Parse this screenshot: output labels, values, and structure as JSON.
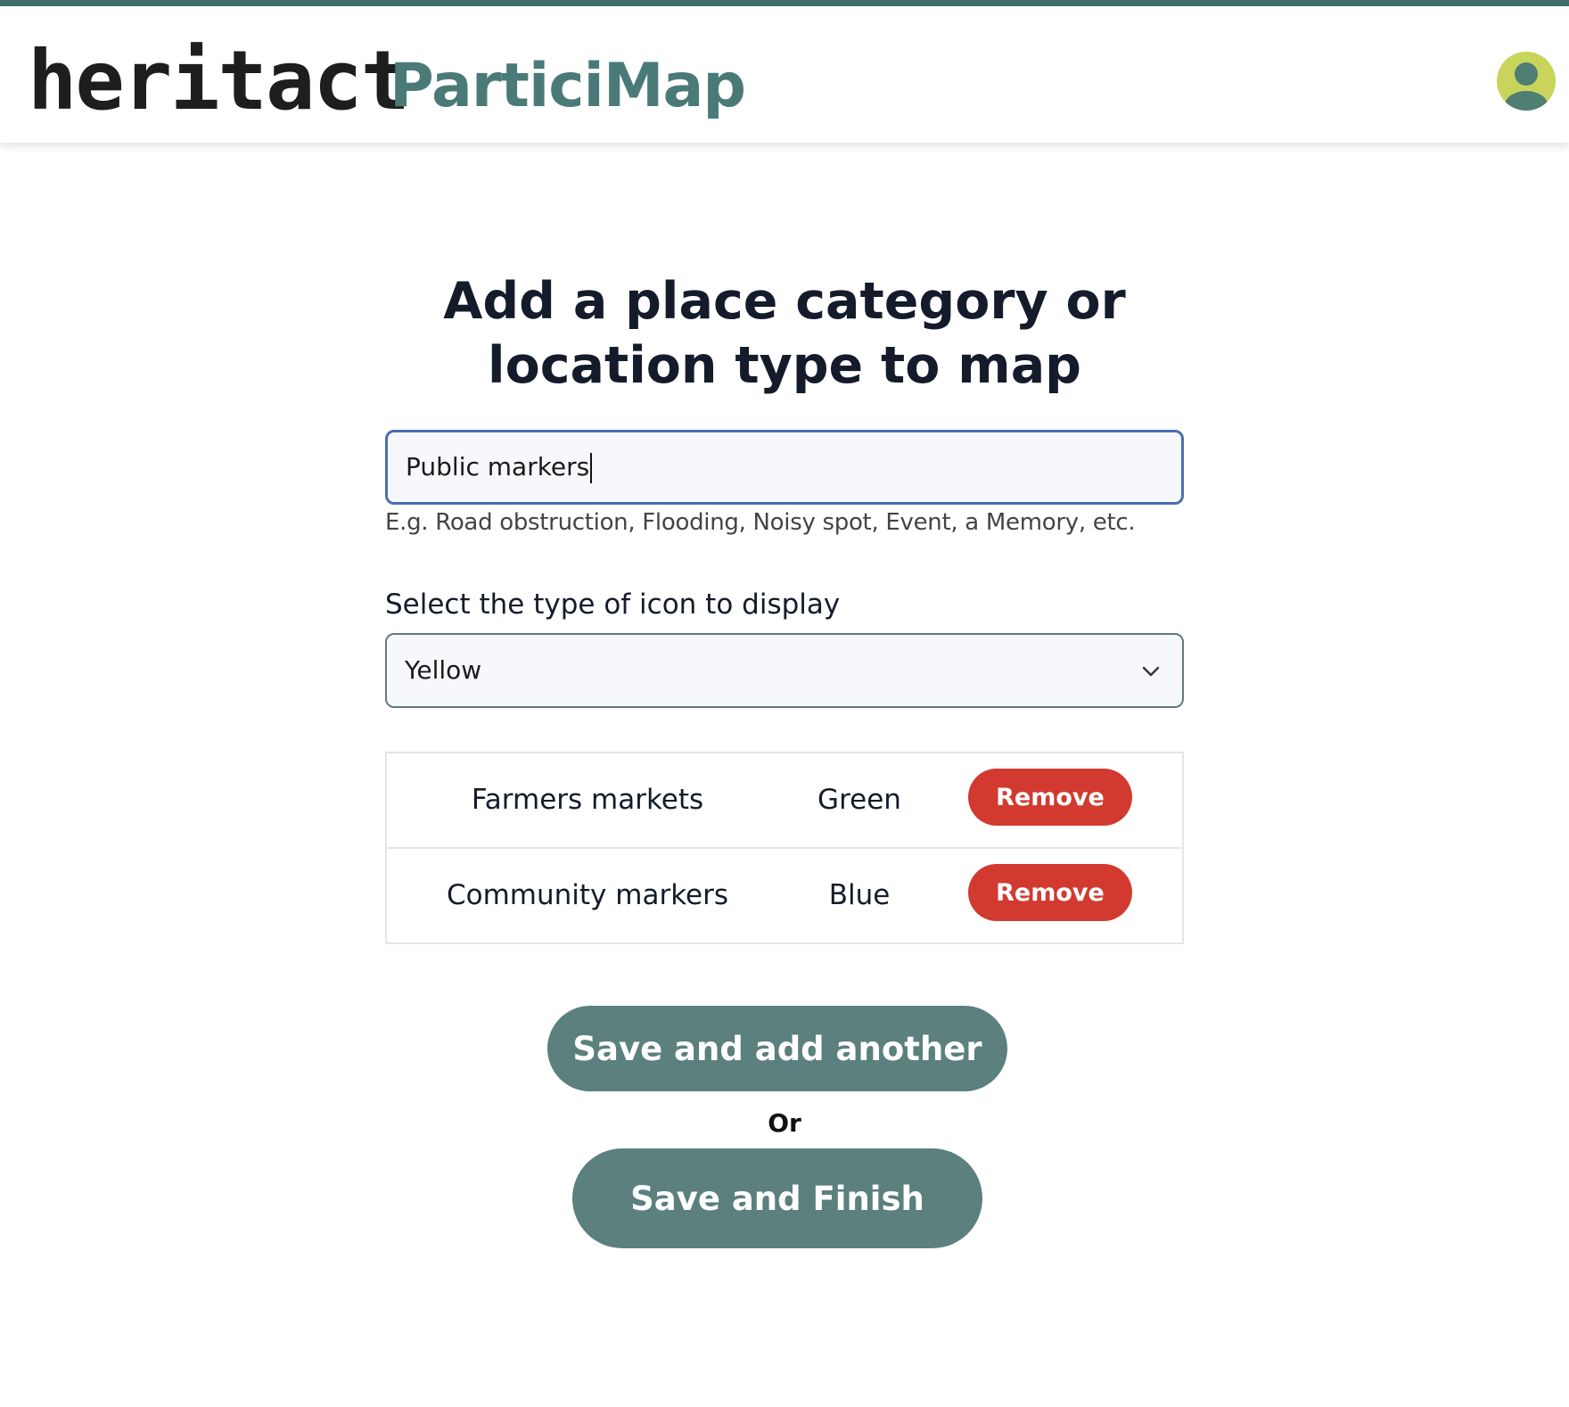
{
  "header": {
    "logo_text": "heritact",
    "app_name": "ParticiMap",
    "avatar_icon": "user-avatar-icon"
  },
  "form": {
    "title": "Add a place category or location type to map",
    "category_input": {
      "value": "Public markers",
      "hint": "E.g. Road obstruction, Flooding, Noisy spot, Event, a Memory, etc."
    },
    "icon_select": {
      "label": "Select the type of icon to display",
      "selected": "Yellow",
      "icon": "chevron-down-icon"
    }
  },
  "categories": [
    {
      "name": "Farmers markets",
      "color": "Green",
      "remove_label": "Remove"
    },
    {
      "name": "Community markers",
      "color": "Blue",
      "remove_label": "Remove"
    }
  ],
  "actions": {
    "save_add_label": "Save and add another",
    "or_text": "Or",
    "save_finish_label": "Save and Finish"
  },
  "colors": {
    "accent": "#3f6e6b",
    "brand_text": "#4a7a78",
    "primary_button": "#5b807d",
    "danger_button": "#d23a30",
    "avatar_bg": "#c9d45c"
  }
}
